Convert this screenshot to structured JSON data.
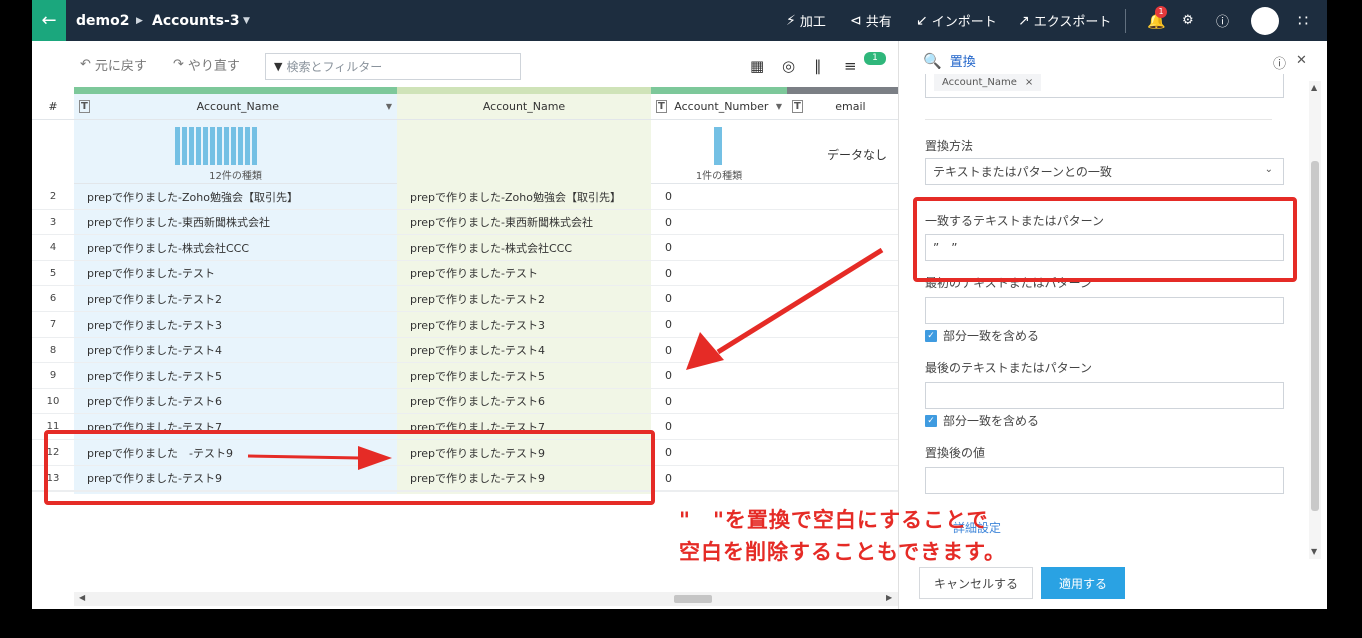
{
  "topbar": {
    "project": "demo2",
    "dataset": "Accounts-3",
    "actions": [
      {
        "label": "加工",
        "icon": "transform-icon"
      },
      {
        "label": "共有",
        "icon": "share-icon"
      },
      {
        "label": "インポート",
        "icon": "import-icon"
      },
      {
        "label": "エクスポート",
        "icon": "export-icon"
      }
    ],
    "notification_count": "1"
  },
  "toolbar": {
    "undo_label": "元に戻す",
    "redo_label": "やり直す",
    "search_placeholder": "検索とフィルター",
    "badge_count": "1"
  },
  "grid": {
    "rownum_header": "#",
    "columns": [
      {
        "name": "Account_Name",
        "type": "T",
        "profile_label": "12件の種類"
      },
      {
        "name": "Account_Name",
        "type": "",
        "profile_label": ""
      },
      {
        "name": "Account_Number",
        "type": "T",
        "profile_label": "1件の種類"
      },
      {
        "name": "email",
        "type": "T",
        "profile_label": "データなし"
      }
    ],
    "rows": [
      {
        "num": "2",
        "a": "prepで作りました-Zoho勉強会【取引先】",
        "b": "prepで作りました-Zoho勉強会【取引先】",
        "c": "0"
      },
      {
        "num": "3",
        "a": "prepで作りました-東西新聞株式会社",
        "b": "prepで作りました-東西新聞株式会社",
        "c": "0"
      },
      {
        "num": "4",
        "a": "prepで作りました-株式会社CCC",
        "b": "prepで作りました-株式会社CCC",
        "c": "0"
      },
      {
        "num": "5",
        "a": "prepで作りました-テスト",
        "b": "prepで作りました-テスト",
        "c": "0"
      },
      {
        "num": "6",
        "a": "prepで作りました-テスト2",
        "b": "prepで作りました-テスト2",
        "c": "0"
      },
      {
        "num": "7",
        "a": "prepで作りました-テスト3",
        "b": "prepで作りました-テスト3",
        "c": "0"
      },
      {
        "num": "8",
        "a": "prepで作りました-テスト4",
        "b": "prepで作りました-テスト4",
        "c": "0"
      },
      {
        "num": "9",
        "a": "prepで作りました-テスト5",
        "b": "prepで作りました-テスト5",
        "c": "0"
      },
      {
        "num": "10",
        "a": "prepで作りました-テスト6",
        "b": "prepで作りました-テスト6",
        "c": "0"
      },
      {
        "num": "11",
        "a": "prepで作りました-テスト7",
        "b": "prepで作りました-テスト7",
        "c": "0"
      },
      {
        "num": "12",
        "a": "prepで作りました　-テスト9",
        "b": "prepで作りました-テスト9",
        "c": "0"
      },
      {
        "num": "13",
        "a": "prepで作りました-テスト9",
        "b": "prepで作りました-テスト9",
        "c": "0"
      }
    ]
  },
  "panel": {
    "title": "置換",
    "chip": "Account_Name",
    "method_label": "置換方法",
    "method_value": "テキストまたはパターンとの一致",
    "match_label": "一致するテキストまたはパターン",
    "match_value": "”　”",
    "first_label": "最初のテキストまたはパターン",
    "first_checkbox": "部分一致を含める",
    "last_label": "最後のテキストまたはパターン",
    "last_checkbox": "部分一致を含める",
    "replace_label": "置換後の値",
    "link_partial": "詳細設定",
    "cancel": "キャンセルする",
    "apply": "適用する"
  },
  "annotation": {
    "line1": "\"　\"を置換で空白にすることで",
    "line2": "空白を削除することもできます。",
    "color": "#e52b26"
  }
}
